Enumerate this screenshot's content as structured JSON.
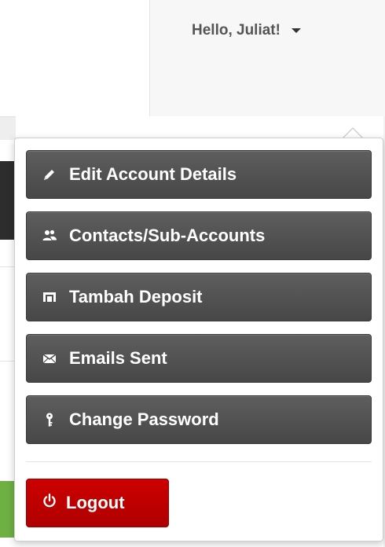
{
  "header": {
    "greeting": "Hello, Juliat!",
    "caret_icon": "caret-down-icon"
  },
  "menu": {
    "items": [
      {
        "label": "Edit Account Details",
        "icon": "pencil-icon"
      },
      {
        "label": "Contacts/Sub-Accounts",
        "icon": "users-icon"
      },
      {
        "label": "Tambah Deposit",
        "icon": "deposit-icon"
      },
      {
        "label": "Emails Sent",
        "icon": "envelope-icon"
      },
      {
        "label": "Change Password",
        "icon": "key-icon"
      }
    ],
    "logout": {
      "label": "Logout",
      "icon": "power-icon"
    }
  },
  "colors": {
    "menu_button": "#4f4f4f",
    "logout_button": "#c00000",
    "greeting_text": "#555555",
    "background_green": "#6fb043"
  }
}
